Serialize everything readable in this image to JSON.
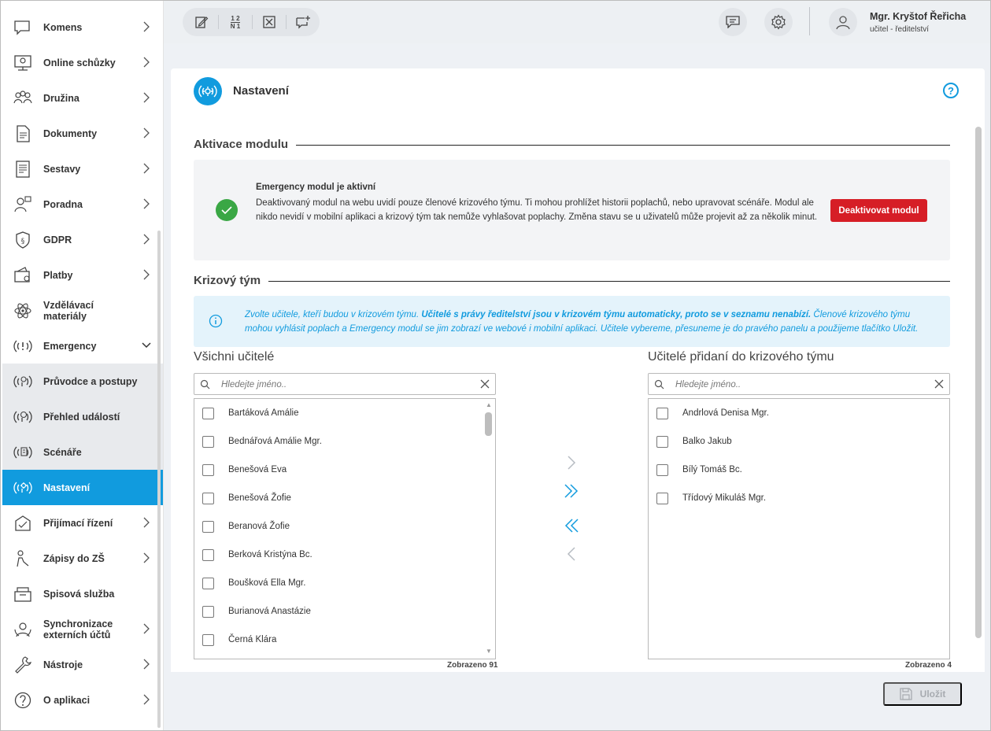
{
  "sidebar": {
    "items": [
      {
        "label": "Komens",
        "icon": "chat-icon",
        "chevron": true
      },
      {
        "label": "Online schůzky",
        "icon": "online-meeting-icon",
        "chevron": true
      },
      {
        "label": "Družina",
        "icon": "group-icon",
        "chevron": true
      },
      {
        "label": "Dokumenty",
        "icon": "document-icon",
        "chevron": true
      },
      {
        "label": "Sestavy",
        "icon": "report-icon",
        "chevron": true
      },
      {
        "label": "Poradna",
        "icon": "counseling-icon",
        "chevron": true
      },
      {
        "label": "GDPR",
        "icon": "gdpr-shield-icon",
        "chevron": true
      },
      {
        "label": "Platby",
        "icon": "wallet-icon",
        "chevron": true
      },
      {
        "label": "Vzdělávací materiály",
        "icon": "atom-icon",
        "chevron": false
      },
      {
        "label": "Emergency",
        "icon": "emergency-icon",
        "chevron": true,
        "expanded": true
      },
      {
        "label": "Průvodce a postupy",
        "icon": "emergency-guide-icon",
        "chevron": false,
        "sub": true
      },
      {
        "label": "Přehled událostí",
        "icon": "emergency-events-icon",
        "chevron": false,
        "sub": true
      },
      {
        "label": "Scénáře",
        "icon": "emergency-scenarios-icon",
        "chevron": false,
        "sub": true
      },
      {
        "label": "Nastavení",
        "icon": "emergency-settings-icon",
        "chevron": false,
        "sub": true,
        "active": true
      },
      {
        "label": "Přijímací řízení",
        "icon": "admission-icon",
        "chevron": true
      },
      {
        "label": "Zápisy do ZŠ",
        "icon": "enrollment-icon",
        "chevron": true
      },
      {
        "label": "Spisová služba",
        "icon": "archive-icon",
        "chevron": false
      },
      {
        "label": "Synchronizace externích účtů",
        "icon": "sync-icon",
        "chevron": true
      },
      {
        "label": "Nástroje",
        "icon": "wrench-icon",
        "chevron": true
      },
      {
        "label": "O aplikaci",
        "icon": "question-icon",
        "chevron": true
      }
    ]
  },
  "topbar": {
    "user_name": "Mgr. Kryštof Řeřicha",
    "user_role": "učitel - ředitelství",
    "tool_numbers_top": "1 2",
    "tool_numbers_bottom": "N 1"
  },
  "page": {
    "title": "Nastavení",
    "help": "?"
  },
  "activation": {
    "section_title": "Aktivace modulu",
    "status_title": "Emergency modul je aktivní",
    "status_text": "Deaktivovaný modul na webu uvidí pouze členové krizového týmu. Ti mohou prohlížet historii poplachů, nebo upravovat scénáře. Modul ale nikdo nevidí v mobilní aplikaci a krizový tým tak nemůže vyhlašovat poplachy. Změna stavu se u uživatelů může projevit až za několik minut.",
    "deactivate_label": "Deaktivovat modul"
  },
  "team": {
    "section_title": "Krizový tým",
    "info_part1": "Zvolte učitele, kteří budou v krizovém týmu. ",
    "info_bold": "Učitelé s právy ředitelství jsou v krizovém týmu automaticky, proto se v seznamu nenabízí.",
    "info_part2": " Členové krizového týmu mohou vyhlásit poplach a Emergency modul se jim zobrazí ve webové i mobilní aplikaci. Učitele vybereme, přesuneme je do pravého panelu a použijeme tlačítko Uložit.",
    "all_title": "Všichni učitelé",
    "added_title": "Učitelé přidaní do krizového týmu",
    "search_placeholder": "Hledejte jméno..",
    "all_teachers": [
      "Bartáková Amálie",
      "Bednářová Amálie Mgr.",
      "Benešová Eva",
      "Benešová Žofie",
      "Beranová Žofie",
      "Berková Kristýna Bc.",
      "Boušková Ella Mgr.",
      "Burianová Anastázie",
      "Černá Klára"
    ],
    "added_teachers": [
      "Andrlová Denisa Mgr.",
      "Balko Jakub",
      "Bílý Tomáš Bc.",
      "Třídový Mikuláš Mgr."
    ],
    "all_count": "Zobrazeno 91",
    "added_count": "Zobrazeno 4"
  },
  "footer": {
    "save_label": "Uložit"
  },
  "colors": {
    "accent": "#119bde",
    "danger": "#d61e26",
    "success": "#3aa745"
  }
}
